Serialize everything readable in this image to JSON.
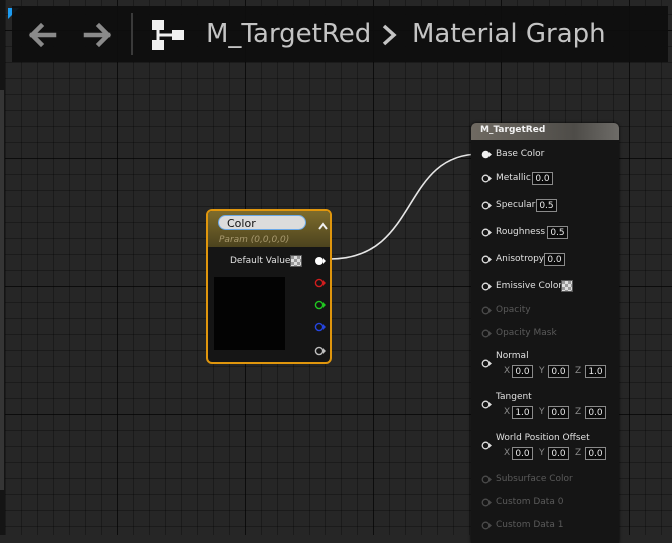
{
  "toolbar": {
    "back_icon": "arrow-left-icon",
    "forward_icon": "arrow-right-icon",
    "graph_icon": "material-graph-icon",
    "breadcrumb": {
      "material": "M_TargetRed",
      "separator_icon": "chevron-right-icon",
      "graph": "Material Graph"
    }
  },
  "color_node": {
    "name": "Color",
    "subtitle": "Param (0,0,0,0)",
    "default_value_label": "Default Value",
    "preview_color": "#030303",
    "output_pins": [
      {
        "channel": "rgba",
        "color": "#ffffff"
      },
      {
        "channel": "r",
        "color": "#d21d1d"
      },
      {
        "channel": "g",
        "color": "#20c820"
      },
      {
        "channel": "b",
        "color": "#2545e0"
      },
      {
        "channel": "a",
        "color": "#bfbfbf"
      }
    ]
  },
  "material_node": {
    "title": "M_TargetRed",
    "inputs": {
      "base_color": {
        "label": "Base Color",
        "connected": true
      },
      "metallic": {
        "label": "Metallic",
        "value": "0.0"
      },
      "specular": {
        "label": "Specular",
        "value": "0.5"
      },
      "roughness": {
        "label": "Roughness",
        "value": "0.5"
      },
      "anisotropy": {
        "label": "Anisotropy",
        "value": "0.0"
      },
      "emissive_color": {
        "label": "Emissive Color"
      },
      "opacity": {
        "label": "Opacity",
        "enabled": false
      },
      "opacity_mask": {
        "label": "Opacity Mask",
        "enabled": false
      },
      "normal": {
        "label": "Normal",
        "x": "0.0",
        "y": "0.0",
        "z": "1.0"
      },
      "tangent": {
        "label": "Tangent",
        "x": "1.0",
        "y": "0.0",
        "z": "0.0"
      },
      "world_position_offset": {
        "label": "World Position Offset",
        "x": "0.0",
        "y": "0.0",
        "z": "0.0"
      },
      "subsurface_color": {
        "label": "Subsurface Color",
        "enabled": false
      },
      "custom_data_0": {
        "label": "Custom Data 0",
        "enabled": false
      },
      "custom_data_1": {
        "label": "Custom Data 1",
        "enabled": false
      }
    },
    "axis_labels": {
      "x": "X",
      "y": "Y",
      "z": "Z"
    }
  },
  "colors": {
    "selection_outline": "#e0960d",
    "wire": "#e6e6e6",
    "graph_background": "#262626"
  }
}
